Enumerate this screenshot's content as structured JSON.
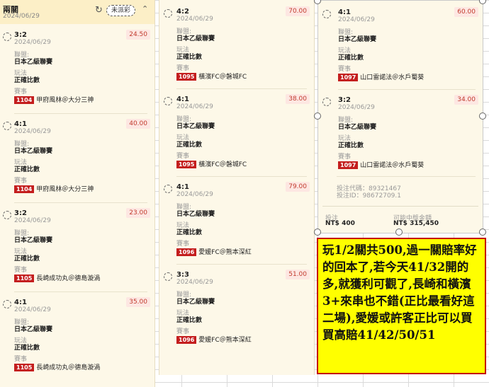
{
  "parlay": {
    "title": "兩關",
    "date": "2024/06/29",
    "status_label": "未派彩",
    "refresh_icon": "refresh-icon",
    "collapse_icon": "chevron-up-icon"
  },
  "labels": {
    "league": "聯盟:",
    "play": "玩法",
    "match": "賽事"
  },
  "col1": [
    {
      "score": "3:2",
      "date": "2024/06/29",
      "odds": "24.50",
      "league": "日本乙級聯賽",
      "play": "正確比數",
      "match_id": "1104",
      "match": "甲府風林＠大分三神"
    },
    {
      "score": "4:1",
      "date": "2024/06/29",
      "odds": "40.00",
      "league": "日本乙級聯賽",
      "play": "正確比數",
      "match_id": "1104",
      "match": "甲府風林＠大分三神"
    },
    {
      "score": "3:2",
      "date": "2024/06/29",
      "odds": "23.00",
      "league": "日本乙級聯賽",
      "play": "正確比數",
      "match_id": "1105",
      "match": "長崎成功丸＠德島漩渦"
    },
    {
      "score": "4:1",
      "date": "2024/06/29",
      "odds": "35.00",
      "league": "日本乙級聯賽",
      "play": "正確比數",
      "match_id": "1105",
      "match": "長崎成功丸＠德島漩渦"
    }
  ],
  "col2": [
    {
      "score": "4:2",
      "date": "2024/06/29",
      "odds": "70.00",
      "league": "日本乙級聯賽",
      "play": "正確比數",
      "match_id": "1095",
      "match": "橫濱FC＠磐城FC"
    },
    {
      "score": "4:1",
      "date": "2024/06/29",
      "odds": "38.00",
      "league": "日本乙級聯賽",
      "play": "正確比數",
      "match_id": "1095",
      "match": "橫濱FC＠磐城FC"
    },
    {
      "score": "4:1",
      "date": "2024/06/29",
      "odds": "79.00",
      "league": "日本乙級聯賽",
      "play": "正確比數",
      "match_id": "1096",
      "match": "愛媛FC＠熊本深紅"
    },
    {
      "score": "3:3",
      "date": "2024/06/29",
      "odds": "51.00",
      "league": "日本乙級聯賽",
      "play": "正確比數",
      "match_id": "1096",
      "match": "愛媛FC＠熊本深紅"
    }
  ],
  "col3": [
    {
      "score": "4:1",
      "date": "2024/06/29",
      "odds": "60.00",
      "league": "日本乙級聯賽",
      "play": "正確比數",
      "match_id": "1097",
      "match": "山口雷諾法＠水戶蜀葵"
    },
    {
      "score": "3:2",
      "date": "2024/06/29",
      "odds": "34.00",
      "league": "日本乙級聯賽",
      "play": "正確比數",
      "match_id": "1097",
      "match": "山口雷諾法＠水戶蜀葵"
    }
  ],
  "footer": {
    "code_line": "投注代碼：89321467",
    "id_line": "投注ID：98672709.1",
    "stake_label": "投注",
    "stake_value": "NT$ 400",
    "payout_label": "可能中獎金額",
    "payout_value": "NT$ 315,450"
  },
  "note": "玩1/2關共500,過一關賠率好的回本了,若今天41/32開的多,就獲利可觀了,長崎和橫濱3+來串也不錯(正比最看好這二場),愛媛或許客正比可以買買高賠41/42/50/51",
  "colors": {
    "note_bg": "#ffff00",
    "note_border": "#c40000",
    "match_badge": "#c41e1e",
    "odds_text": "#c23b2e"
  }
}
